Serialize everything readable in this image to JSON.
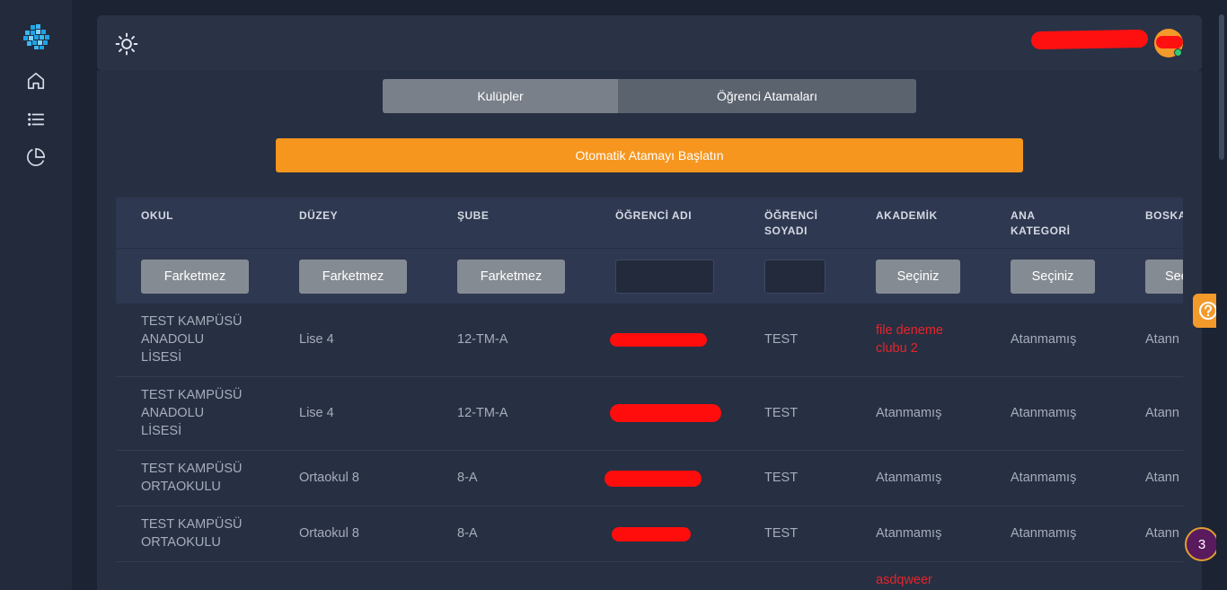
{
  "tabs": [
    {
      "label": "Kulüpler",
      "active": true
    },
    {
      "label": "Öğrenci Atamaları",
      "active": false
    }
  ],
  "auto_assign_label": "Otomatik Atamayı Başlatın",
  "columns": [
    [
      "OKUL"
    ],
    [
      "DÜZEY"
    ],
    [
      "ŞUBE"
    ],
    [
      "ÖĞRENCİ ADI"
    ],
    [
      "ÖĞRENCİ",
      "SOYADI"
    ],
    [
      "AKADEMİK"
    ],
    [
      "ANA",
      "KATEGORİ"
    ],
    [
      "BOSKA"
    ]
  ],
  "filters": {
    "okul": "Farketmez",
    "duzey": "Farketmez",
    "sube": "Farketmez",
    "ogrenci_adi": "",
    "ogrenci_soyadi": "",
    "akademik": "Seçiniz",
    "ana_kategori": "Seçiniz",
    "boska": "Seç"
  },
  "rows": [
    {
      "okul": [
        "TEST KAMPÜSÜ",
        "ANADOLU",
        "LİSESİ"
      ],
      "duzey": "Lise 4",
      "sube": "12-TM-A",
      "soyadi": "TEST",
      "akademik": [
        "file deneme",
        "clubu 2"
      ],
      "ana_kategori": "Atanmamış",
      "boska": "Atann"
    },
    {
      "okul": [
        "TEST KAMPÜSÜ",
        "ANADOLU",
        "LİSESİ"
      ],
      "duzey": "Lise 4",
      "sube": "12-TM-A",
      "soyadi": "TEST",
      "akademik": [
        "Atanmamış"
      ],
      "ana_kategori": "Atanmamış",
      "boska": "Atann"
    },
    {
      "okul": [
        "TEST KAMPÜSÜ",
        "ORTAOKULU"
      ],
      "duzey": "Ortaokul 8",
      "sube": "8-A",
      "soyadi": "TEST",
      "akademik": [
        "Atanmamış"
      ],
      "ana_kategori": "Atanmamış",
      "boska": "Atann"
    },
    {
      "okul": [
        "TEST KAMPÜSÜ",
        "ORTAOKULU"
      ],
      "duzey": "Ortaokul 8",
      "sube": "8-A",
      "soyadi": "TEST",
      "akademik": [
        "Atanmamış"
      ],
      "ana_kategori": "Atanmamış",
      "boska": "Atann"
    },
    {
      "okul": [],
      "duzey": "",
      "sube": "",
      "soyadi": "",
      "akademik": [
        "asdqweer"
      ],
      "ana_kategori": "",
      "boska": ""
    }
  ],
  "notification_count": "3",
  "colors": {
    "accent": "#f6961e",
    "danger": "#e5252a",
    "online": "#2ecc71"
  },
  "icons": [
    "logo-icon",
    "home-icon",
    "list-icon",
    "pie-chart-icon",
    "sun-icon",
    "help-icon"
  ]
}
